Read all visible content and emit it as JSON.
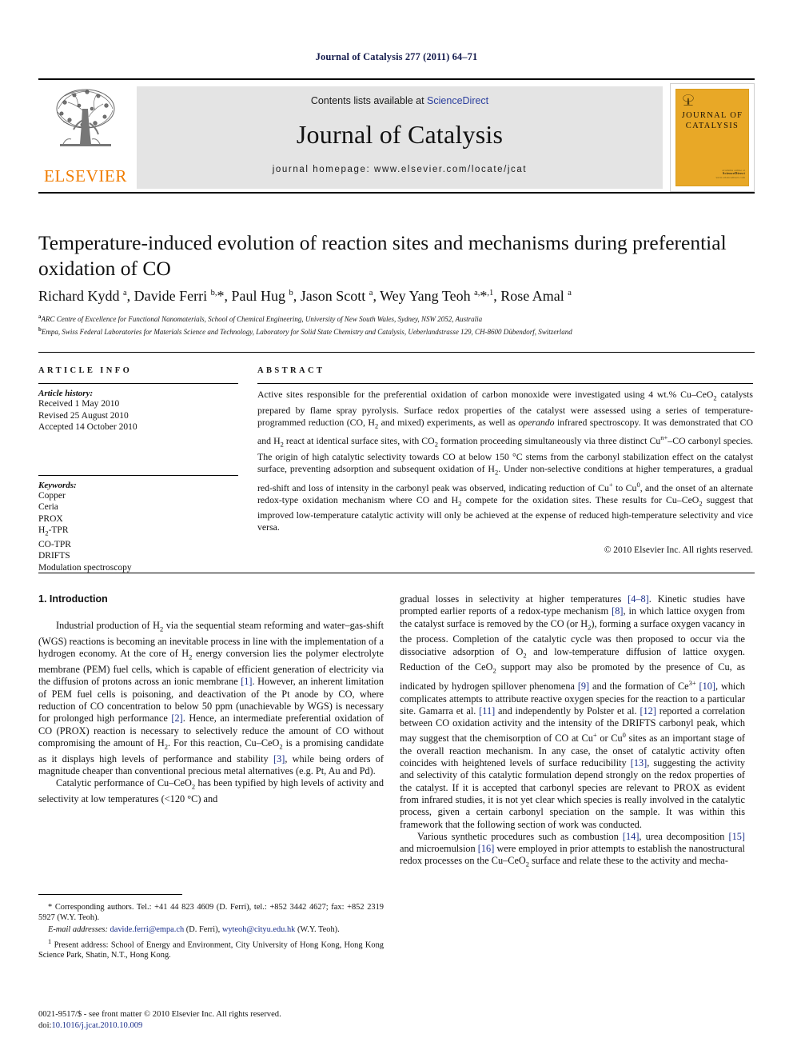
{
  "running_head": "Journal of Catalysis 277 (2011) 64–71",
  "masthead": {
    "publisher": "ELSEVIER",
    "contents_prefix": "Contents lists available at ",
    "contents_link": "ScienceDirect",
    "journal_name": "Journal of Catalysis",
    "homepage": "journal homepage: www.elsevier.com/locate/jcat",
    "cover": {
      "line1": "JOURNAL OF",
      "line2": "CATALYSIS",
      "foot_small": "available online at",
      "foot_brand": "ScienceDirect",
      "foot_url": "www.sciencedirect.com"
    }
  },
  "article": {
    "title": "Temperature-induced evolution of reaction sites and mechanisms during preferential oxidation of CO",
    "authors_html": "Richard Kydd <sup>a</sup>, Davide Ferri <sup>b,</sup>*, Paul Hug <sup>b</sup>, Jason Scott <sup>a</sup>, Wey Yang Teoh <sup>a,</sup>*<sup>,1</sup>, Rose Amal <sup>a</sup>",
    "affiliation_a": "ARC Centre of Excellence for Functional Nanomaterials, School of Chemical Engineering, University of New South Wales, Sydney, NSW 2052, Australia",
    "affiliation_b": "Empa, Swiss Federal Laboratories for Materials Science and Technology, Laboratory for Solid State Chemistry and Catalysis, Ueberlandstrasse 129, CH-8600 Dübendorf, Switzerland"
  },
  "article_info": {
    "heading": "ARTICLE INFO",
    "history_label": "Article history:",
    "history": [
      "Received 1 May 2010",
      "Revised 25 August 2010",
      "Accepted 14 October 2010"
    ],
    "keywords_label": "Keywords:",
    "keywords_html": [
      "Copper",
      "Ceria",
      "PROX",
      "H<sub>2</sub>-TPR",
      "CO-TPR",
      "DRIFTS",
      "Modulation spectroscopy"
    ]
  },
  "abstract": {
    "heading": "ABSTRACT",
    "body_html": "Active sites responsible for the preferential oxidation of carbon monoxide were investigated using 4 wt.% Cu–CeO<sub>2</sub> catalysts prepared by flame spray pyrolysis. Surface redox properties of the catalyst were assessed using a series of temperature-programmed reduction (CO, H<sub>2</sub> and mixed) experiments, as well as <i>operando</i> infrared spectroscopy. It was demonstrated that CO and H<sub>2</sub> react at identical surface sites, with CO<sub>2</sub> formation proceeding simultaneously via three distinct Cu<sup>n+</sup>–CO carbonyl species. The origin of high catalytic selectivity towards CO at below 150 °C stems from the carbonyl stabilization effect on the catalyst surface, preventing adsorption and subsequent oxidation of H<sub>2</sub>. Under non-selective conditions at higher temperatures, a gradual red-shift and loss of intensity in the carbonyl peak was observed, indicating reduction of Cu<sup>+</sup> to Cu<sup>0</sup>, and the onset of an alternate redox-type oxidation mechanism where CO and H<sub>2</sub> compete for the oxidation sites. These results for Cu–CeO<sub>2</sub> suggest that improved low-temperature catalytic activity will only be achieved at the expense of reduced high-temperature selectivity and vice versa.",
    "copyright": "© 2010 Elsevier Inc. All rights reserved."
  },
  "introduction": {
    "heading": "1. Introduction",
    "left_paragraphs_html": [
      "Industrial production of H<sub>2</sub> via the sequential steam reforming and water–gas-shift (WGS) reactions is becoming an inevitable process in line with the implementation of a hydrogen economy. At the core of H<sub>2</sub> energy conversion lies the polymer electrolyte membrane (PEM) fuel cells, which is capable of efficient generation of electricity via the diffusion of protons across an ionic membrane <span class=\"ref\">[1]</span>. However, an inherent limitation of PEM fuel cells is poisoning, and deactivation of the Pt anode by CO, where reduction of CO concentration to below 50 ppm (unachievable by WGS) is necessary for prolonged high performance <span class=\"ref\">[2]</span>. Hence, an intermediate preferential oxidation of CO (PROX) reaction is necessary to selectively reduce the amount of CO without compromising the amount of H<sub>2</sub>. For this reaction, Cu–CeO<sub>2</sub> is a promising candidate as it displays high levels of performance and stability <span class=\"ref\">[3]</span>, while being orders of magnitude cheaper than conventional precious metal alternatives (e.g. Pt, Au and Pd).",
      "Catalytic performance of Cu–CeO<sub>2</sub> has been typified by high levels of activity and selectivity at low temperatures (&lt;120 °C) and"
    ],
    "right_paragraphs_html": [
      "gradual losses in selectivity at higher temperatures <span class=\"ref\">[4–8]</span>. Kinetic studies have prompted earlier reports of a redox-type mechanism <span class=\"ref\">[8]</span>, in which lattice oxygen from the catalyst surface is removed by the CO (or H<sub>2</sub>), forming a surface oxygen vacancy in the process. Completion of the catalytic cycle was then proposed to occur via the dissociative adsorption of O<sub>2</sub> and low-temperature diffusion of lattice oxygen. Reduction of the CeO<sub>2</sub> support may also be promoted by the presence of Cu, as indicated by hydrogen spillover phenomena <span class=\"ref\">[9]</span> and the formation of Ce<sup>3+</sup> <span class=\"ref\">[10]</span>, which complicates attempts to attribute reactive oxygen species for the reaction to a particular site. Gamarra et al. <span class=\"ref\">[11]</span> and independently by Polster et al. <span class=\"ref\">[12]</span> reported a correlation between CO oxidation activity and the intensity of the DRIFTS carbonyl peak, which may suggest that the chemisorption of CO at Cu<sup>+</sup> or Cu<sup>0</sup> sites as an important stage of the overall reaction mechanism. In any case, the onset of catalytic activity often coincides with heightened levels of surface reducibility <span class=\"ref\">[13]</span>, suggesting the activity and selectivity of this catalytic formulation depend strongly on the redox properties of the catalyst. If it is accepted that carbonyl species are relevant to PROX as evident from infrared studies, it is not yet clear which species is really involved in the catalytic process, given a certain carbonyl speciation on the sample. It was within this framework that the following section of work was conducted.",
      "Various synthetic procedures such as combustion <span class=\"ref\">[14]</span>, urea decomposition <span class=\"ref\">[15]</span> and microemulsion <span class=\"ref\">[16]</span> were employed in prior attempts to establish the nanostructural redox processes on the Cu–CeO<sub>2</sub> surface and relate these to the activity and mecha-"
    ]
  },
  "footnotes": {
    "corresponding_html": "* Corresponding authors. Tel.: +41 44 823 4609 (D. Ferri), tel.: +852 3442 4627; fax: +852 2319 5927 (W.Y. Teoh).",
    "email_html": "<i>E-mail addresses:</i> <span class=\"mono-link\">davide.ferri@empa.ch</span> (D. Ferri), <span class=\"mono-link\">wyteoh@cityu.edu.hk</span> (W.Y. Teoh).",
    "present_address_html": "<sup>1</sup> Present address: School of Energy and Environment, City University of Hong Kong, Hong Kong Science Park, Shatin, N.T., Hong Kong."
  },
  "imprint": {
    "issn_line": "0021-9517/$ - see front matter © 2010 Elsevier Inc. All rights reserved.",
    "doi_prefix": "doi:",
    "doi": "10.1016/j.jcat.2010.10.009"
  }
}
